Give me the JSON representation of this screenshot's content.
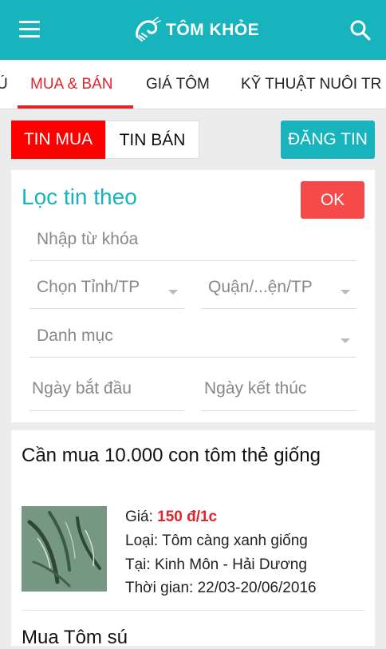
{
  "app": {
    "title": "TÔM KHỎE"
  },
  "tabs": [
    {
      "label": "Ú"
    },
    {
      "label": "MUA & BÁN"
    },
    {
      "label": "GIÁ TÔM"
    },
    {
      "label": "KỸ THUẬT NUÔI TR"
    }
  ],
  "segments": {
    "buy": "TIN MUA",
    "sell": "TIN BÁN"
  },
  "post_button": "ĐĂNG TIN",
  "filter": {
    "title": "Lọc tin theo",
    "ok": "OK",
    "keyword_placeholder": "Nhập từ khóa",
    "province": "Chọn Tỉnh/TP",
    "district": "Quận/...ện/TP",
    "category": "Danh mục",
    "start_date": "Ngày bắt đầu",
    "end_date": "Ngày kết thúc"
  },
  "posts": [
    {
      "title": "Cần mua 10.000 con tôm thẻ giống",
      "price_label": "Giá: ",
      "price": "150 đ/1c",
      "type": "Loại: Tôm càng xanh giống",
      "location": "Tại: Kinh Môn - Hải Dương",
      "time": "Thời gian: 22/03-20/06/2016"
    },
    {
      "title": "Mua Tôm sú"
    }
  ],
  "colors": {
    "primary": "#17b4bd",
    "accent": "#e0242b",
    "buy_segment": "#ff0000",
    "ok_button": "#f44a4a"
  }
}
